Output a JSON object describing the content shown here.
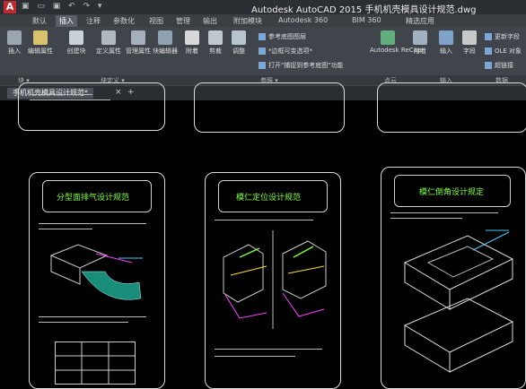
{
  "app": {
    "logo_letter": "A",
    "quick_access": "▣ ▭ ▣ ↶ ↷ ▾",
    "title": "Autodesk AutoCAD 2015   手机机壳模具设计规范.dwg"
  },
  "menu_tabs": [
    "默认",
    "插入",
    "注释",
    "参数化",
    "视图",
    "管理",
    "输出",
    "附加模块",
    "Autodesk 360",
    "BIM 360",
    "精选应用"
  ],
  "active_tab": "插入",
  "ribbon": {
    "block_group": [
      "插入",
      "编辑属性"
    ],
    "block_def_group": [
      "创建块",
      "定义属性",
      "管理属性",
      "块编辑器"
    ],
    "reference_group": [
      "附着",
      "剪裁",
      "调整"
    ],
    "reference_options": [
      "参考底图图层",
      "*边框可变选项*",
      "打开\"捕捉到参考底图\"功能"
    ],
    "recap": "Autodesk ReCap",
    "attach2": "附着",
    "import": "输入",
    "field": "字段",
    "data_group": [
      "更新字段",
      "OLE 对象",
      "超链接"
    ]
  },
  "panel_labels": [
    "块 ▾",
    "块定义 ▾",
    "参照 ▾",
    "点云",
    "输入",
    "数据"
  ],
  "document_tab": {
    "name": "手机机壳模具设计规范*",
    "close": "×",
    "new": "+"
  },
  "pages": [
    {
      "title": "分型面排气设计规范"
    },
    {
      "title": "模仁定位设计规范"
    },
    {
      "title": "模仁倒角设计规定"
    }
  ],
  "colors": {
    "title_green": "#7fff3c",
    "ribbon_bg": "#3f454b",
    "tab_bar": "#3a3f44",
    "cad_red": "#c1272d"
  }
}
